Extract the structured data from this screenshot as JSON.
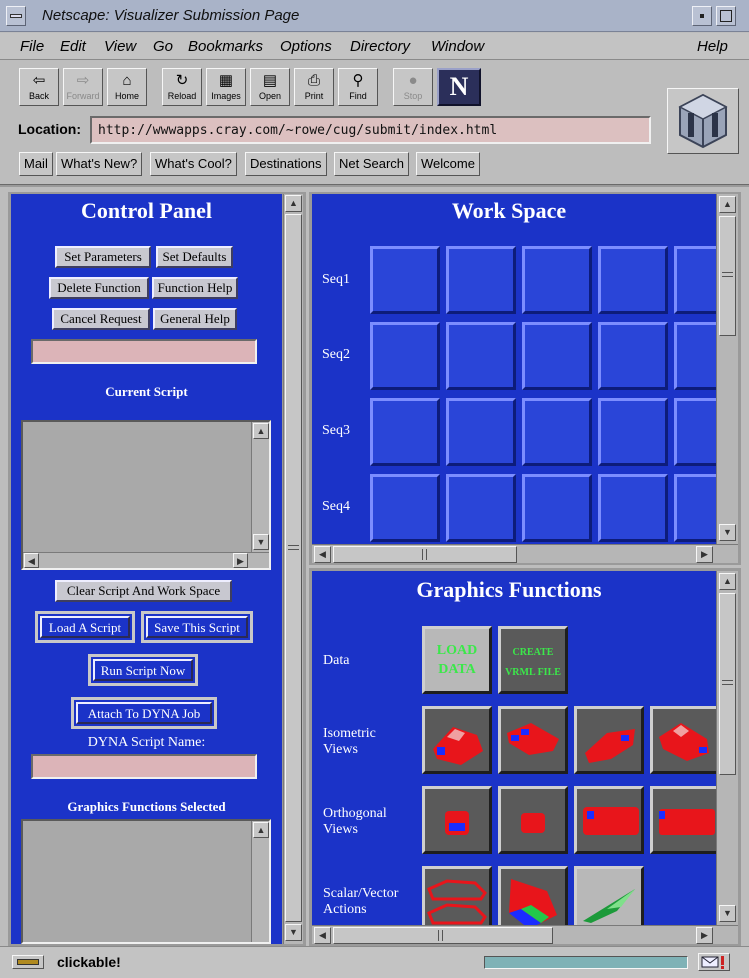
{
  "window": {
    "title": "Netscape: Visualizer Submission Page"
  },
  "menu": [
    "File",
    "Edit",
    "View",
    "Go",
    "Bookmarks",
    "Options",
    "Directory",
    "Window",
    "Help"
  ],
  "toolbar": [
    {
      "label": "Back",
      "icon": "⇦",
      "enabled": true
    },
    {
      "label": "Forward",
      "icon": "⇨",
      "enabled": false
    },
    {
      "label": "Home",
      "icon": "⌂",
      "enabled": true
    },
    {
      "label": "Reload",
      "icon": "↻",
      "enabled": true
    },
    {
      "label": "Images",
      "icon": "▦",
      "enabled": true
    },
    {
      "label": "Open",
      "icon": "▤",
      "enabled": true
    },
    {
      "label": "Print",
      "icon": "⎙",
      "enabled": true
    },
    {
      "label": "Find",
      "icon": "⚲",
      "enabled": true
    },
    {
      "label": "Stop",
      "icon": "●",
      "enabled": false
    }
  ],
  "netscape_logo_letter": "N",
  "location": {
    "label": "Location:",
    "url": "http://wwwapps.cray.com/~rowe/cug/submit/index.html"
  },
  "directory_buttons": [
    "Mail",
    "What's New?",
    "What's Cool?",
    "Destinations",
    "Net Search",
    "Welcome"
  ],
  "control_panel": {
    "title": "Control Panel",
    "buttons_row1": [
      "Set Parameters",
      "Set Defaults"
    ],
    "buttons_row2": [
      "Delete Function",
      "Function Help"
    ],
    "buttons_row3": [
      "Cancel Request",
      "General Help"
    ],
    "current_script_label": "Current Script",
    "clear_button": "Clear Script And Work Space",
    "load_button": "Load A Script",
    "save_button": "Save This Script",
    "run_button": "Run Script Now",
    "attach_button": "Attach To DYNA Job",
    "dyna_label": "DYNA Script Name:",
    "graphics_selected_label": "Graphics Functions Selected"
  },
  "work_space": {
    "title": "Work Space",
    "sequences": [
      "Seq1",
      "Seq2",
      "Seq3",
      "Seq4"
    ]
  },
  "graphics_functions": {
    "title": "Graphics Functions",
    "rows": [
      {
        "label": "Data",
        "tiles": [
          {
            "text": "LOAD DATA"
          },
          {
            "text": "CREATE VRML FILE"
          }
        ]
      },
      {
        "label": "Isometric Views",
        "tiles": [
          "iso-view-1",
          "iso-view-2",
          "iso-view-3",
          "iso-view-4"
        ]
      },
      {
        "label": "Orthogonal Views",
        "tiles": [
          "front-view",
          "rear-view",
          "top-view",
          "side-view"
        ]
      },
      {
        "label": "Scalar/Vector Actions",
        "tiles": [
          "deformed-shape",
          "fringe-plot",
          "vector-plot"
        ]
      }
    ]
  },
  "status": {
    "text": "clickable!"
  },
  "colors": {
    "frame_bg": "#1b33c8",
    "chrome": "#c3c3c3",
    "title_bar": "#a9b3c8",
    "load_text": "#3be84a",
    "car": "#e8151b"
  }
}
